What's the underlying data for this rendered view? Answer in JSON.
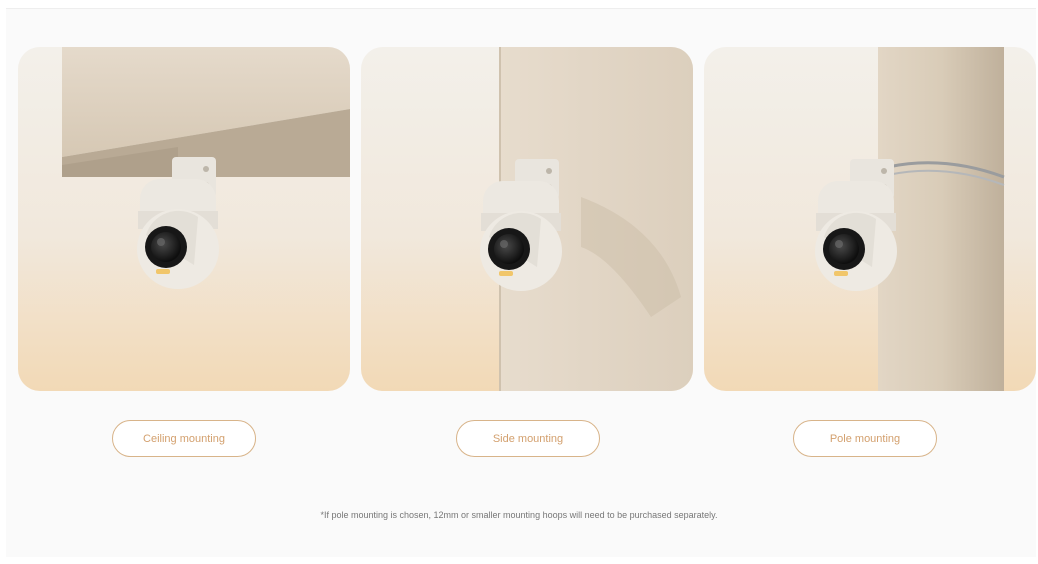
{
  "options": [
    {
      "label": "Ceiling mounting",
      "image": "ceiling-mount-camera-photo"
    },
    {
      "label": "Side mounting",
      "image": "side-mount-camera-photo"
    },
    {
      "label": "Pole mounting",
      "image": "pole-mount-camera-photo"
    }
  ],
  "note": "*If pole mounting is chosen, 12mm or smaller mounting hoops will need to be purchased separately.",
  "colors": {
    "button_border": "#d8b48a",
    "button_text": "#d3a06e",
    "background": "#fafafa"
  }
}
